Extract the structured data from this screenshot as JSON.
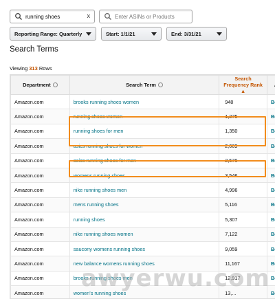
{
  "search": {
    "value": "running shoes",
    "clear_label": "x",
    "asin_placeholder": "Enter ASINs or Products"
  },
  "filters": {
    "reporting_range": "Reporting Range: Quarterly",
    "start": "Start: 1/1/21",
    "end": "End: 3/31/21"
  },
  "page_title": "Search Terms",
  "rows_info": {
    "prefix": "Viewing",
    "count": "313",
    "suffix": "Rows"
  },
  "table": {
    "columns": [
      "Department",
      "Search Term",
      "Search Frequency Rank",
      "A"
    ],
    "sort_arrow": "▲",
    "rows": [
      {
        "dept": "Amazon.com",
        "term": "brooks running shoes women",
        "rank": "948",
        "extra": "Bo"
      },
      {
        "dept": "Amazon.com",
        "term": "running shoes women",
        "rank": "1,275",
        "extra": "Bo"
      },
      {
        "dept": "Amazon.com",
        "term": "running shoes for men",
        "rank": "1,350",
        "extra": "Bo"
      },
      {
        "dept": "Amazon.com",
        "term": "asics running shoes for women",
        "rank": "2,069",
        "extra": "Bo"
      },
      {
        "dept": "Amazon.com",
        "term": "asics running shoes for men",
        "rank": "2,576",
        "extra": "Bo"
      },
      {
        "dept": "Amazon.com",
        "term": "womens running shoes",
        "rank": "3,546",
        "extra": "Bo"
      },
      {
        "dept": "Amazon.com",
        "term": "nike running shoes men",
        "rank": "4,996",
        "extra": "Bo"
      },
      {
        "dept": "Amazon.com",
        "term": "mens running shoes",
        "rank": "5,116",
        "extra": "Bo"
      },
      {
        "dept": "Amazon.com",
        "term": "running shoes",
        "rank": "5,307",
        "extra": "Bo"
      },
      {
        "dept": "Amazon.com",
        "term": "nike running shoes women",
        "rank": "7,122",
        "extra": "Bo"
      },
      {
        "dept": "Amazon.com",
        "term": "saucony womens running shoes",
        "rank": "9,059",
        "extra": "Bo"
      },
      {
        "dept": "Amazon.com",
        "term": "new balance womens running shoes",
        "rank": "11,167",
        "extra": "Bo"
      },
      {
        "dept": "Amazon.com",
        "term": "brooks running shoes men",
        "rank": "12,917",
        "extra": "Bo"
      },
      {
        "dept": "Amazon.com",
        "term": "women's running shoes",
        "rank": "13,...",
        "extra": "Bo"
      }
    ]
  },
  "watermark": "awyerwu.com",
  "colors": {
    "highlight": "#f28c1c",
    "link": "#007185",
    "sort_accent": "#c45500"
  }
}
